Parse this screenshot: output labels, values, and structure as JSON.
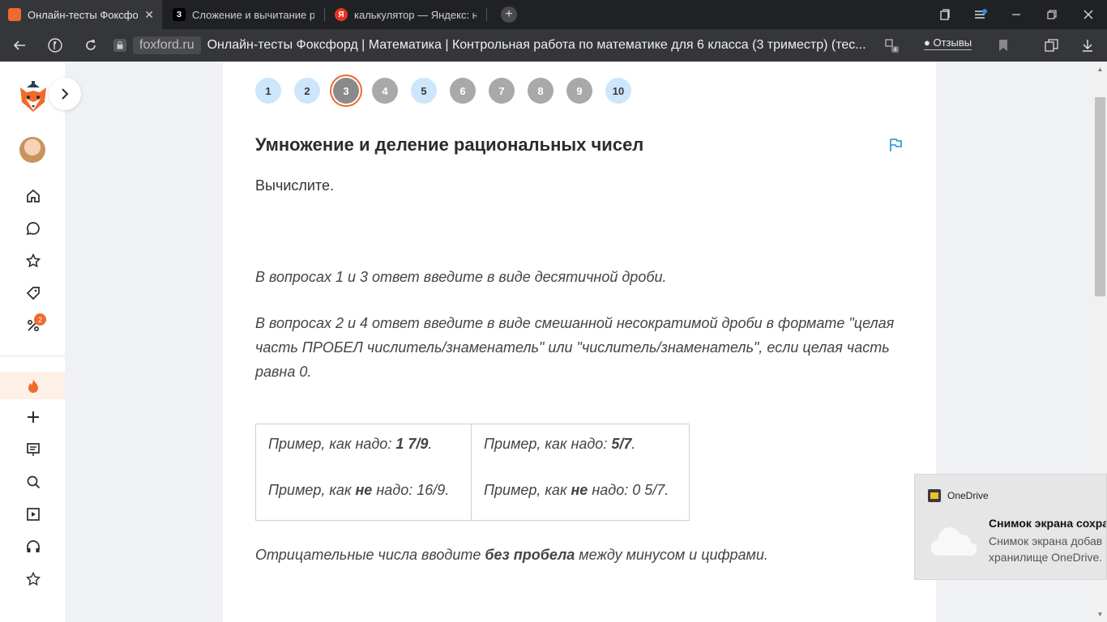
{
  "browser": {
    "tabs": [
      {
        "title": "Онлайн-тесты Фоксфорд",
        "active": true,
        "icon": "fox-icon"
      },
      {
        "title": "Сложение и вычитание р",
        "active": false,
        "icon": "znanija-icon",
        "fav_letter": "З"
      },
      {
        "title": "калькулятор — Яндекс: на",
        "active": false,
        "icon": "yandex-icon",
        "fav_letter": "Я"
      }
    ],
    "new_tab_label": "+",
    "domain": "foxford.ru",
    "page_title": "Онлайн-тесты Фоксфорд | Математика | Контрольная работа по математике для 6 класса (3 триместр) (тес...",
    "reviews_label": "Отзывы",
    "extension_count": "4",
    "close_tab_glyph": "✕"
  },
  "sidebar": {
    "items": [
      {
        "name": "home",
        "icon": "home-icon"
      },
      {
        "name": "chat",
        "icon": "chat-icon"
      },
      {
        "name": "favorites",
        "icon": "star-icon"
      },
      {
        "name": "tags",
        "icon": "tag-icon"
      },
      {
        "name": "discounts",
        "icon": "percent-icon",
        "badge": "2"
      },
      {
        "name": "streak",
        "icon": "fire-icon"
      },
      {
        "name": "add",
        "icon": "plus-icon"
      },
      {
        "name": "courses",
        "icon": "board-icon"
      },
      {
        "name": "search",
        "icon": "search-icon"
      },
      {
        "name": "video",
        "icon": "play-icon"
      },
      {
        "name": "support",
        "icon": "headphones-icon"
      },
      {
        "name": "rate",
        "icon": "star-outline-icon"
      }
    ]
  },
  "quiz": {
    "questions": [
      {
        "label": "1",
        "state": "answered"
      },
      {
        "label": "2",
        "state": "answered"
      },
      {
        "label": "3",
        "state": "current"
      },
      {
        "label": "4",
        "state": "unanswered"
      },
      {
        "label": "5",
        "state": "answered"
      },
      {
        "label": "6",
        "state": "unanswered"
      },
      {
        "label": "7",
        "state": "unanswered"
      },
      {
        "label": "8",
        "state": "unanswered"
      },
      {
        "label": "9",
        "state": "unanswered"
      },
      {
        "label": "10",
        "state": "answered"
      }
    ],
    "title": "Умножение и деление рациональных чисел",
    "prompt": "Вычислите.",
    "note1": "В вопросах 1 и 3 ответ введите в виде десятичной дроби.",
    "note2": "В вопросах 2 и 4 ответ введите в виде смешанной несократимой дроби в формате \"целая часть ПРОБЕЛ числитель/знаменатель\" или \"числитель/знаменатель\", если целая часть равна 0.",
    "examples": {
      "good_prefix": "Пример, как надо: ",
      "bad_prefix_1": "Пример, как ",
      "bad_not": "не",
      "bad_prefix_2": " надо: ",
      "col1_good": "1 7/9",
      "col1_bad": "16/9.",
      "col2_good": "5/7",
      "col2_bad": "0 5/7.",
      "dot": "."
    },
    "note3_prefix": "Отрицательные числа вводите ",
    "note3_bold": "без пробела",
    "note3_suffix": " между минусом и цифрами."
  },
  "toast": {
    "app": "OneDrive",
    "title": "Снимок экрана сохра",
    "body_line1": "Снимок экрана добав",
    "body_line2": "хранилище OneDrive."
  },
  "colors": {
    "accent_orange": "#f06a2b",
    "answered_blue": "#cde6fb",
    "unanswered_gray": "#a9a9a9",
    "flag_blue": "#1f8fd6"
  }
}
